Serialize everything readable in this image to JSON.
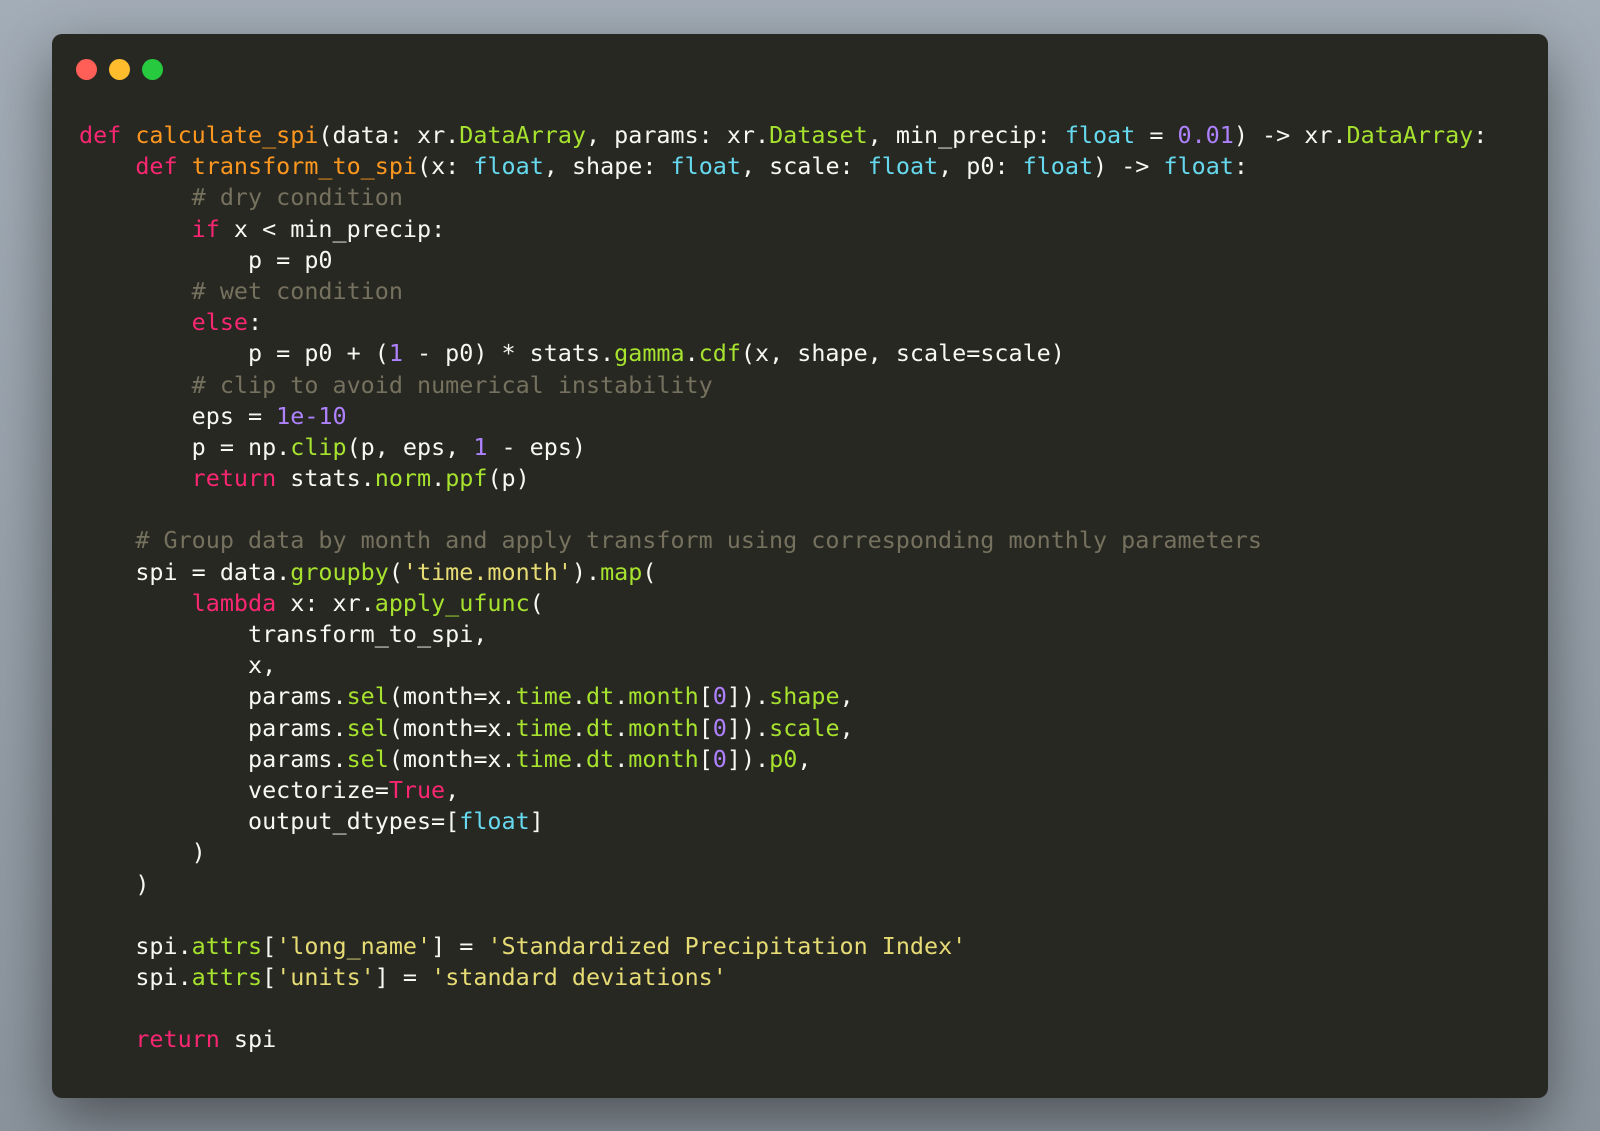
{
  "window": {
    "controls": [
      "close",
      "minimize",
      "maximize"
    ],
    "colors": {
      "close": "#ff5f56",
      "minimize": "#ffbd2e",
      "maximize": "#27c93f",
      "background": "#272822"
    }
  },
  "code": {
    "language": "python",
    "lines": [
      [
        [
          "kw",
          "def "
        ],
        [
          "fn",
          "calculate_spi"
        ],
        [
          "pl",
          "(data: xr."
        ],
        [
          "gr",
          "DataArray"
        ],
        [
          "pl",
          ", params: xr."
        ],
        [
          "gr",
          "Dataset"
        ],
        [
          "pl",
          ", min_precip: "
        ],
        [
          "ty",
          "float"
        ],
        [
          "pl",
          " = "
        ],
        [
          "nm",
          "0.01"
        ],
        [
          "pl",
          ") -> xr."
        ],
        [
          "gr",
          "DataArray"
        ],
        [
          "pl",
          ":"
        ]
      ],
      [
        [
          "pl",
          "    "
        ],
        [
          "kw",
          "def "
        ],
        [
          "fn",
          "transform_to_spi"
        ],
        [
          "pl",
          "(x: "
        ],
        [
          "ty",
          "float"
        ],
        [
          "pl",
          ", shape: "
        ],
        [
          "ty",
          "float"
        ],
        [
          "pl",
          ", scale: "
        ],
        [
          "ty",
          "float"
        ],
        [
          "pl",
          ", p0: "
        ],
        [
          "ty",
          "float"
        ],
        [
          "pl",
          ") -> "
        ],
        [
          "ty",
          "float"
        ],
        [
          "pl",
          ":"
        ]
      ],
      [
        [
          "pl",
          "        "
        ],
        [
          "cm",
          "# dry condition"
        ]
      ],
      [
        [
          "pl",
          "        "
        ],
        [
          "kw",
          "if"
        ],
        [
          "pl",
          " x < min_precip:"
        ]
      ],
      [
        [
          "pl",
          "            p = p0"
        ]
      ],
      [
        [
          "pl",
          "        "
        ],
        [
          "cm",
          "# wet condition"
        ]
      ],
      [
        [
          "pl",
          "        "
        ],
        [
          "kw",
          "else"
        ],
        [
          "pl",
          ":"
        ]
      ],
      [
        [
          "pl",
          "            p = p0 + ("
        ],
        [
          "nm",
          "1"
        ],
        [
          "pl",
          " - p0) * stats."
        ],
        [
          "gr",
          "gamma"
        ],
        [
          "pl",
          "."
        ],
        [
          "gr",
          "cdf"
        ],
        [
          "pl",
          "(x, shape, scale=scale)"
        ]
      ],
      [
        [
          "pl",
          "        "
        ],
        [
          "cm",
          "# clip to avoid numerical instability"
        ]
      ],
      [
        [
          "pl",
          "        eps = "
        ],
        [
          "nm",
          "1e-10"
        ]
      ],
      [
        [
          "pl",
          "        p = np."
        ],
        [
          "gr",
          "clip"
        ],
        [
          "pl",
          "(p, eps, "
        ],
        [
          "nm",
          "1"
        ],
        [
          "pl",
          " - eps)"
        ]
      ],
      [
        [
          "pl",
          "        "
        ],
        [
          "kw",
          "return"
        ],
        [
          "pl",
          " stats."
        ],
        [
          "gr",
          "norm"
        ],
        [
          "pl",
          "."
        ],
        [
          "gr",
          "ppf"
        ],
        [
          "pl",
          "(p)"
        ]
      ],
      [],
      [
        [
          "pl",
          "    "
        ],
        [
          "cm",
          "# Group data by month and apply transform using corresponding monthly parameters"
        ]
      ],
      [
        [
          "pl",
          "    spi = data."
        ],
        [
          "gr",
          "groupby"
        ],
        [
          "pl",
          "("
        ],
        [
          "st",
          "'time.month'"
        ],
        [
          "pl",
          ")."
        ],
        [
          "gr",
          "map"
        ],
        [
          "pl",
          "("
        ]
      ],
      [
        [
          "pl",
          "        "
        ],
        [
          "kw",
          "lambda"
        ],
        [
          "pl",
          " x: xr."
        ],
        [
          "gr",
          "apply_ufunc"
        ],
        [
          "pl",
          "("
        ]
      ],
      [
        [
          "pl",
          "            transform_to_spi,"
        ]
      ],
      [
        [
          "pl",
          "            x,"
        ]
      ],
      [
        [
          "pl",
          "            params."
        ],
        [
          "gr",
          "sel"
        ],
        [
          "pl",
          "(month=x."
        ],
        [
          "gr",
          "time"
        ],
        [
          "pl",
          "."
        ],
        [
          "gr",
          "dt"
        ],
        [
          "pl",
          "."
        ],
        [
          "gr",
          "month"
        ],
        [
          "pl",
          "["
        ],
        [
          "nm",
          "0"
        ],
        [
          "pl",
          "])."
        ],
        [
          "gr",
          "shape"
        ],
        [
          "pl",
          ","
        ]
      ],
      [
        [
          "pl",
          "            params."
        ],
        [
          "gr",
          "sel"
        ],
        [
          "pl",
          "(month=x."
        ],
        [
          "gr",
          "time"
        ],
        [
          "pl",
          "."
        ],
        [
          "gr",
          "dt"
        ],
        [
          "pl",
          "."
        ],
        [
          "gr",
          "month"
        ],
        [
          "pl",
          "["
        ],
        [
          "nm",
          "0"
        ],
        [
          "pl",
          "])."
        ],
        [
          "gr",
          "scale"
        ],
        [
          "pl",
          ","
        ]
      ],
      [
        [
          "pl",
          "            params."
        ],
        [
          "gr",
          "sel"
        ],
        [
          "pl",
          "(month=x."
        ],
        [
          "gr",
          "time"
        ],
        [
          "pl",
          "."
        ],
        [
          "gr",
          "dt"
        ],
        [
          "pl",
          "."
        ],
        [
          "gr",
          "month"
        ],
        [
          "pl",
          "["
        ],
        [
          "nm",
          "0"
        ],
        [
          "pl",
          "])."
        ],
        [
          "gr",
          "p0"
        ],
        [
          "pl",
          ","
        ]
      ],
      [
        [
          "pl",
          "            vectorize="
        ],
        [
          "kw",
          "True"
        ],
        [
          "pl",
          ","
        ]
      ],
      [
        [
          "pl",
          "            output_dtypes=["
        ],
        [
          "ty",
          "float"
        ],
        [
          "pl",
          "]"
        ]
      ],
      [
        [
          "pl",
          "        )"
        ]
      ],
      [
        [
          "pl",
          "    )"
        ]
      ],
      [],
      [
        [
          "pl",
          "    spi."
        ],
        [
          "gr",
          "attrs"
        ],
        [
          "pl",
          "["
        ],
        [
          "st",
          "'long_name'"
        ],
        [
          "pl",
          "] = "
        ],
        [
          "st",
          "'Standardized Precipitation Index'"
        ]
      ],
      [
        [
          "pl",
          "    spi."
        ],
        [
          "gr",
          "attrs"
        ],
        [
          "pl",
          "["
        ],
        [
          "st",
          "'units'"
        ],
        [
          "pl",
          "] = "
        ],
        [
          "st",
          "'standard deviations'"
        ]
      ],
      [],
      [
        [
          "pl",
          "    "
        ],
        [
          "kw",
          "return"
        ],
        [
          "pl",
          " spi"
        ]
      ]
    ]
  }
}
